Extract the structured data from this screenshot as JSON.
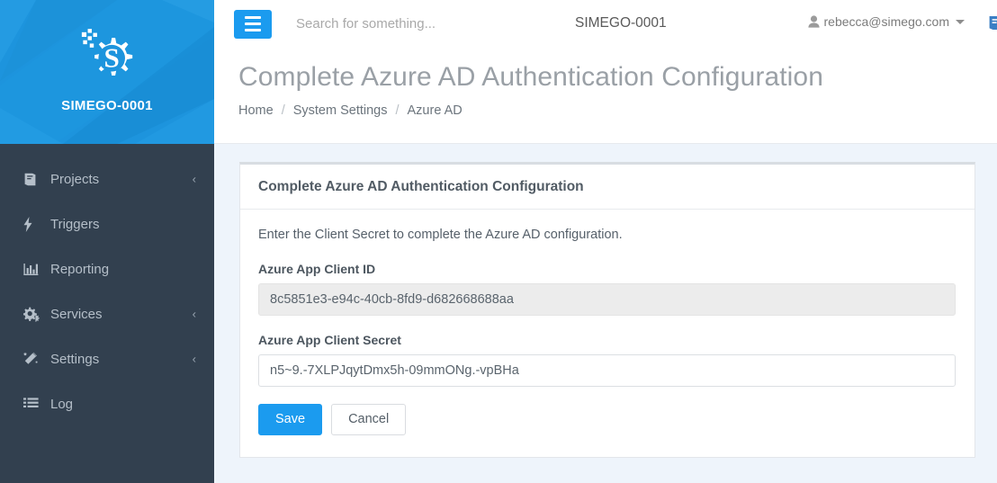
{
  "sidebar": {
    "brand_name": "SIMEGO-0001",
    "logo_icon": "gear-s-logo",
    "items": [
      {
        "label": "Projects",
        "icon": "book-icon",
        "caret": "‹"
      },
      {
        "label": "Triggers",
        "icon": "bolt-icon",
        "caret": ""
      },
      {
        "label": "Reporting",
        "icon": "bar-chart-icon",
        "caret": ""
      },
      {
        "label": "Services",
        "icon": "cogs-icon",
        "caret": "‹"
      },
      {
        "label": "Settings",
        "icon": "magic-wand-icon",
        "caret": "‹"
      },
      {
        "label": "Log",
        "icon": "list-icon",
        "caret": ""
      }
    ]
  },
  "topbar": {
    "menu_toggle_icon": "hamburger-icon",
    "search_placeholder": "Search for something...",
    "search_value": "",
    "tenant": "SIMEGO-0001",
    "book_icon": "book-icon",
    "user_icon": "user-icon",
    "user_email": "rebecca@simego.com",
    "caret_icon": "chevron-down-icon"
  },
  "page": {
    "title": "Complete Azure AD Authentication Configuration",
    "breadcrumb": [
      {
        "label": "Home",
        "current": false
      },
      {
        "label": "System Settings",
        "current": false
      },
      {
        "label": "Azure AD",
        "current": true
      }
    ],
    "breadcrumb_separator": "/"
  },
  "card": {
    "title": "Complete Azure AD Authentication Configuration",
    "lead": "Enter the Client Secret to complete the Azure AD configuration.",
    "fields": [
      {
        "label": "Azure App Client ID",
        "value": "8c5851e3-e94c-40cb-8fd9-d682668688aa",
        "readonly": true
      },
      {
        "label": "Azure App Client Secret",
        "value": "n5~9.-7XLPJqytDmx5h-09mmONg.-vpBHa",
        "readonly": false
      }
    ],
    "save_label": "Save",
    "cancel_label": "Cancel"
  },
  "colors": {
    "accent_blue": "#1b9bef",
    "brand_blue": "#1d94dd",
    "sidebar_dark": "#32404f",
    "page_bg": "#eef4fb"
  }
}
